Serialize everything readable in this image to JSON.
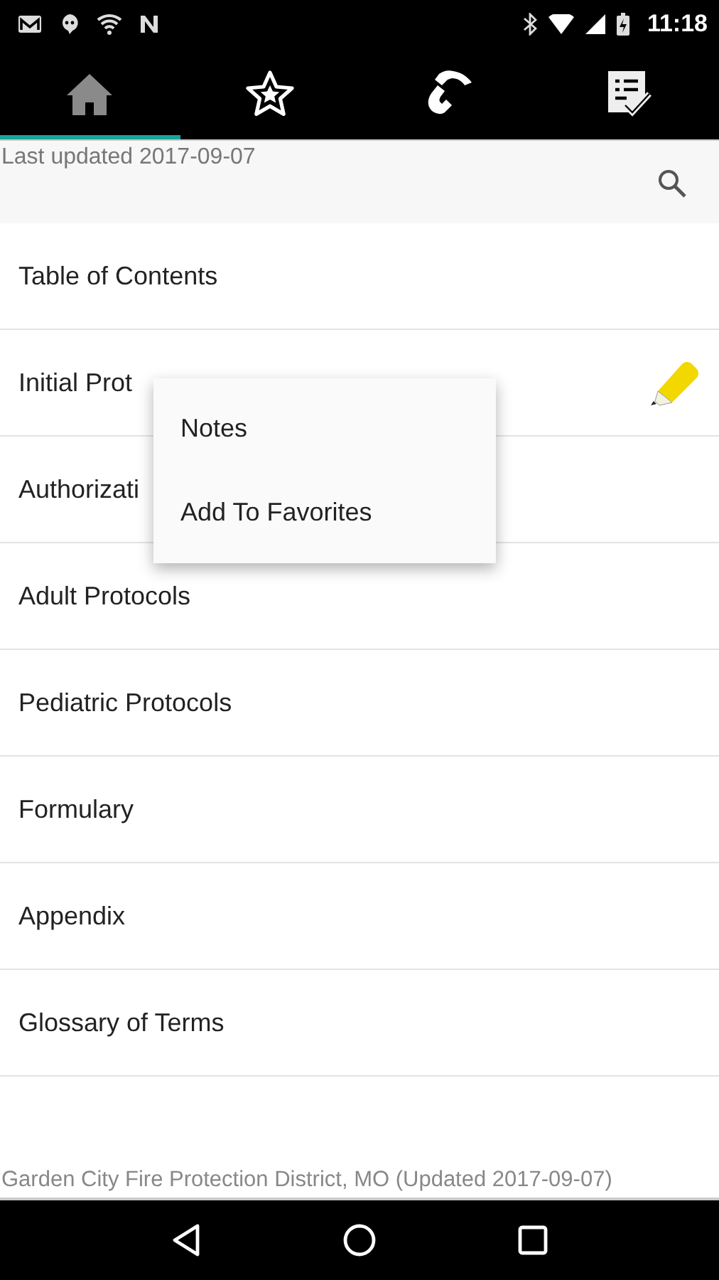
{
  "status_bar": {
    "time": "11:18"
  },
  "tabs": [
    {
      "kind": "home",
      "selected": true
    },
    {
      "kind": "favorites",
      "selected": false
    },
    {
      "kind": "phone",
      "selected": false
    },
    {
      "kind": "checklist",
      "selected": false
    }
  ],
  "header": {
    "updated": "Last updated 2017-09-07"
  },
  "items": [
    {
      "label": "Table of Contents",
      "has_note": false,
      "menu_open": false
    },
    {
      "label": "Initial Prot",
      "has_note": true,
      "menu_open": true
    },
    {
      "label": "Authorizati",
      "has_note": false,
      "menu_open": false
    },
    {
      "label": "Adult Protocols",
      "has_note": false,
      "menu_open": false
    },
    {
      "label": "Pediatric Protocols",
      "has_note": false,
      "menu_open": false
    },
    {
      "label": "Formulary",
      "has_note": false,
      "menu_open": false
    },
    {
      "label": "Appendix",
      "has_note": false,
      "menu_open": false
    },
    {
      "label": "Glossary of Terms",
      "has_note": false,
      "menu_open": false
    }
  ],
  "context_menu": {
    "items": [
      "Notes",
      "Add To Favorites"
    ]
  },
  "footer": "Garden City Fire Protection District, MO (Updated 2017-09-07)"
}
